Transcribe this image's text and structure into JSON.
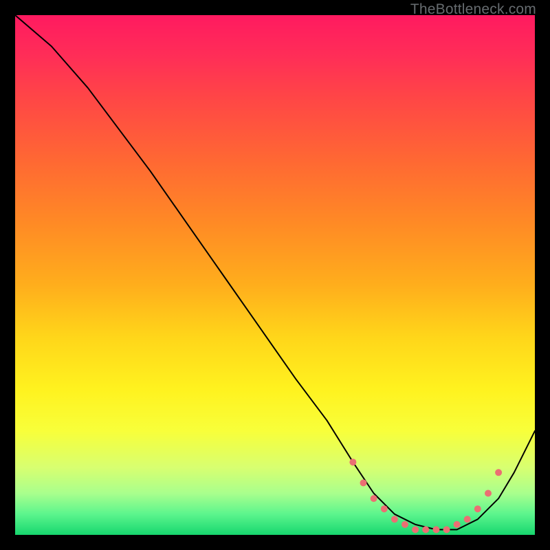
{
  "attribution": "TheBottleneck.com",
  "colors": {
    "background": "#000000",
    "curve": "#000000",
    "dot": "#eb6f73"
  },
  "chart_data": {
    "type": "line",
    "title": "",
    "xlabel": "",
    "ylabel": "",
    "xlim": [
      0,
      100
    ],
    "ylim": [
      0,
      100
    ],
    "grid": false,
    "legend": false,
    "annotations": [
      "TheBottleneck.com"
    ],
    "series": [
      {
        "name": "curve",
        "x": [
          0,
          7,
          14,
          20,
          26,
          33,
          40,
          47,
          54,
          60,
          65,
          69,
          73,
          77,
          81,
          85,
          89,
          93,
          96,
          100
        ],
        "y": [
          100,
          94,
          86,
          78,
          70,
          60,
          50,
          40,
          30,
          22,
          14,
          8,
          4,
          2,
          1,
          1,
          3,
          7,
          12,
          20
        ]
      }
    ],
    "highlight_points": {
      "name": "flat-region-dots",
      "x": [
        65,
        67,
        69,
        71,
        73,
        75,
        77,
        79,
        81,
        83,
        85,
        87,
        89,
        91,
        93
      ],
      "y": [
        14,
        10,
        7,
        5,
        3,
        2,
        1,
        1,
        1,
        1,
        2,
        3,
        5,
        8,
        12
      ]
    }
  }
}
